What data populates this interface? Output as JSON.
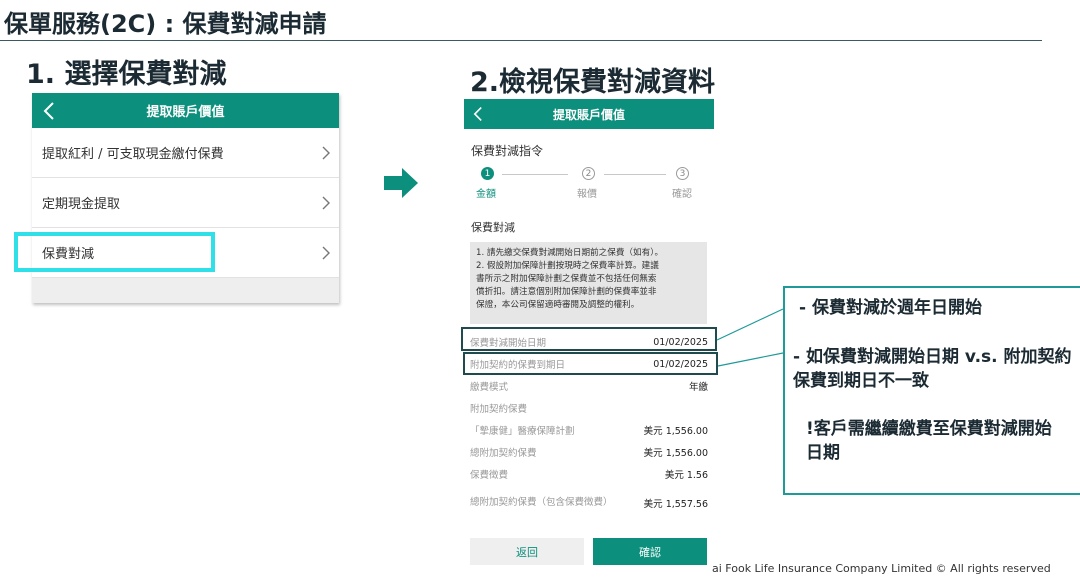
{
  "page_title": "保單服務(2C) : 保費對減申請",
  "step1_heading": "1. 選擇保費對減",
  "step2_heading": "2.檢視保費對減資料",
  "phone1": {
    "header_title": "提取賬戶價值",
    "rows": [
      "提取紅利 / 可支取現金繳付保費",
      "定期現金提取",
      "保費對減"
    ]
  },
  "phone2": {
    "header_title": "提取賬戶價值",
    "section_title": "保費對減指令",
    "steps": [
      {
        "num": "1",
        "label": "金額"
      },
      {
        "num": "2",
        "label": "報價"
      },
      {
        "num": "3",
        "label": "確認"
      }
    ],
    "subtitle": "保費對減",
    "notice_lines": [
      "1. 請先繳交保費對減開始日期前之保費（如有）。",
      "2. 假設附加保障計劃按現時之保費率計算。建議",
      "書所示之附加保障計劃之保費並不包括任何無索",
      "償折扣。請注意個別附加保障計劃的保費率並非",
      "保證，本公司保留適時審閱及調整的權利。"
    ],
    "info_rows": [
      {
        "label": "保費對減開始日期",
        "value": "01/02/2025"
      },
      {
        "label": "附加契約的保費到期日",
        "value": "01/02/2025"
      },
      {
        "label": "繳費模式",
        "value": "年繳"
      },
      {
        "label": "附加契約保費",
        "value": ""
      },
      {
        "label": "「摯康健」醫療保障計劃",
        "value": "美元 1,556.00"
      },
      {
        "label": "總附加契約保費",
        "value": "美元 1,556.00"
      },
      {
        "label": "保費徵費",
        "value": "美元 1.56"
      },
      {
        "label": "總附加契約保費（包含保費徵費）",
        "value": "美元 1,557.56"
      }
    ],
    "back_label": "返回",
    "confirm_label": "確認"
  },
  "callout": {
    "line1": "- 保費對減於週年日開始",
    "line2": "- 如保費對減開始日期 v.s. 附加契約保費到期日不一致",
    "line3": "!客戶需繼續繳費至保費對減開始日期"
  },
  "footer": "ai Fook Life Insurance Company Limited © All rights reserved",
  "colors": {
    "brand": "#0c8f7c",
    "highlight": "#2fe0e8",
    "callout_border": "#1e9a98"
  }
}
